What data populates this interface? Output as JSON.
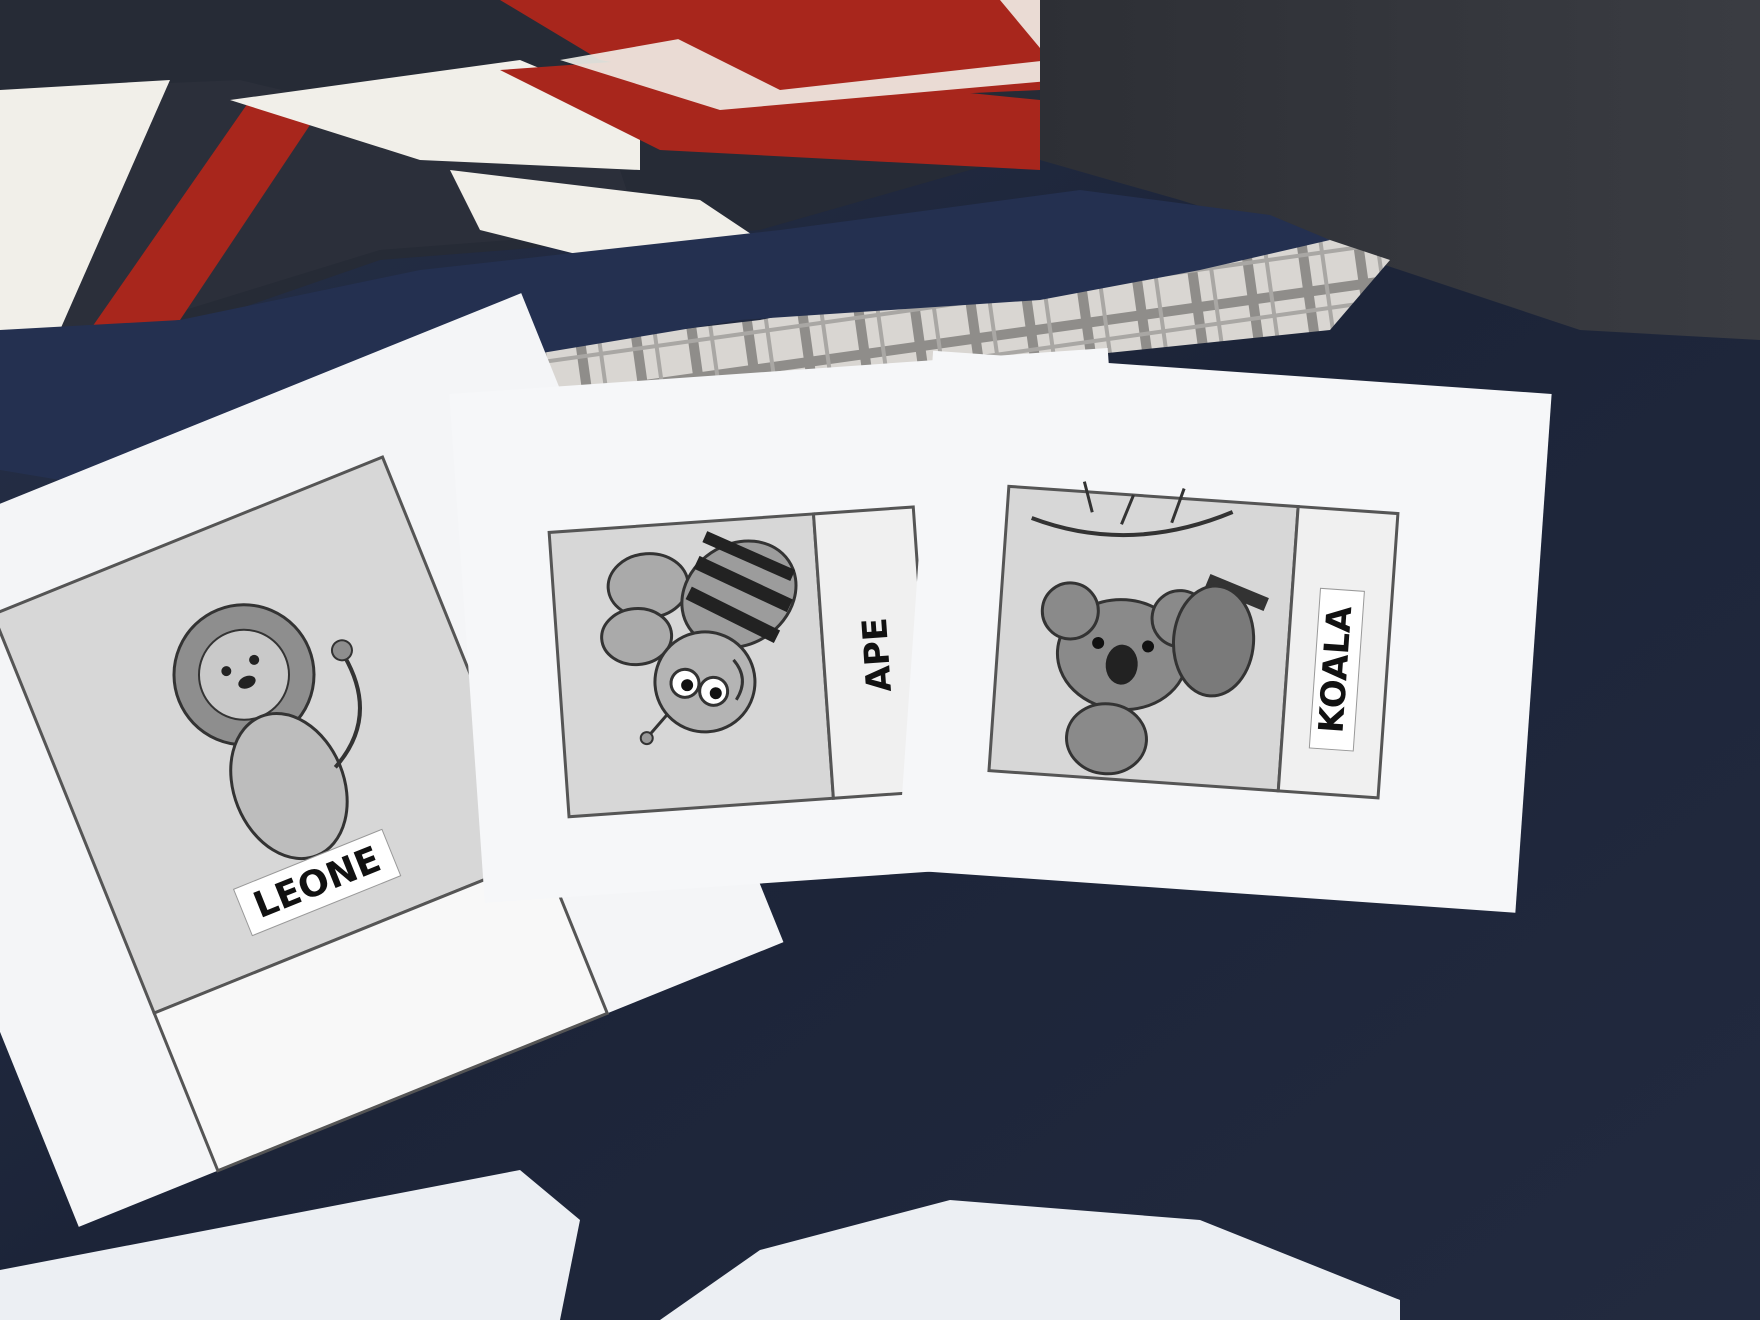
{
  "scene": {
    "description_tag": "photo",
    "colors": {
      "fabric_navy": "#1f2940",
      "fabric_dark": "#262a33",
      "flag_red": "#a8261c",
      "flag_white": "#f1efe9",
      "plaid_light": "#d6d3cf",
      "plaid_dark": "#8d8b88",
      "paper": "#f4f5f7",
      "picture_bg": "#d7d7d7",
      "ink": "#111111"
    }
  },
  "cards": [
    {
      "id": "lion",
      "label": "LEONE",
      "icon": "lion-icon"
    },
    {
      "id": "bee",
      "label": "APE",
      "icon": "bee-icon"
    },
    {
      "id": "koala",
      "label": "KOALA",
      "icon": "koala-icon"
    }
  ]
}
